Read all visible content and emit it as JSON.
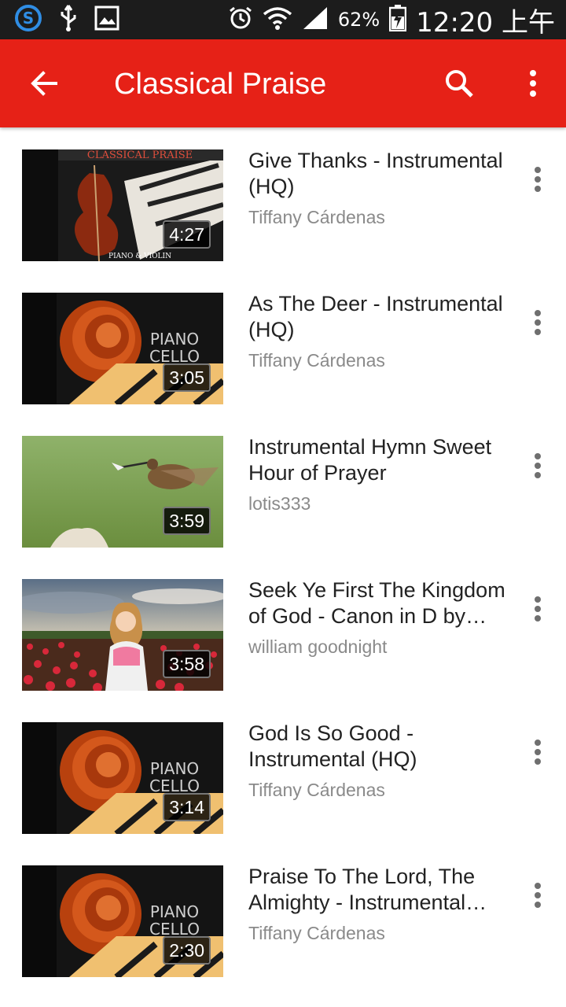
{
  "status_bar": {
    "battery": "62%",
    "time": "12:20 上午",
    "icons": [
      "skype-icon",
      "usb-icon",
      "gallery-icon",
      "alarm-icon",
      "wifi-icon",
      "signal-icon",
      "battery-icon"
    ]
  },
  "app_bar": {
    "title": "Classical Praise",
    "icons": [
      "back-arrow-icon",
      "search-icon",
      "more-vert-icon"
    ],
    "background": "#e62117"
  },
  "videos": [
    {
      "title": "Give Thanks - Instrumental (HQ)",
      "channel": "Tiffany Cárdenas",
      "duration": "4:27",
      "thumb_text": "CLASSICAL PRAISE",
      "thumb_sub": "PIANO & VIOLIN"
    },
    {
      "title": "As The Deer - Instrumental (HQ)",
      "channel": "Tiffany Cárdenas",
      "duration": "3:05",
      "thumb_text": "PIANO",
      "thumb_sub": "CELLO"
    },
    {
      "title": "Instrumental Hymn Sweet Hour of Prayer",
      "channel": "lotis333",
      "duration": "3:59"
    },
    {
      "title": "Seek Ye First The Kingdom of God - Canon in D by…",
      "channel": "william goodnight",
      "duration": "3:58"
    },
    {
      "title": "God Is So Good - Instrumental (HQ)",
      "channel": "Tiffany Cárdenas",
      "duration": "3:14",
      "thumb_text": "PIANO",
      "thumb_sub": "CELLO"
    },
    {
      "title": "Praise To The Lord, The Almighty - Instrumental…",
      "channel": "Tiffany Cárdenas",
      "duration": "2:30",
      "thumb_text": "PIANO",
      "thumb_sub": "CELLO"
    }
  ]
}
